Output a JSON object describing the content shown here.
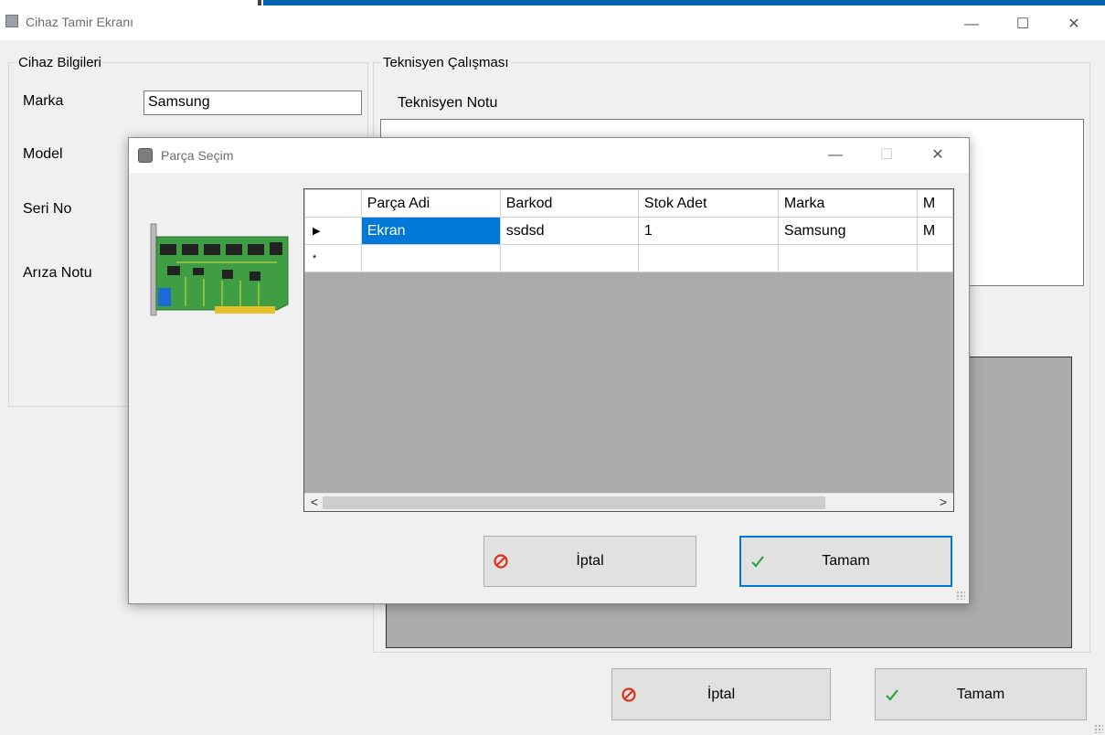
{
  "main_window": {
    "title": "Cihaz Tamir Ekranı",
    "minimize": "—",
    "maximize": "☐",
    "close": "✕"
  },
  "device_group": {
    "legend": "Cihaz Bilgileri",
    "marka_label": "Marka",
    "marka_value": "Samsung",
    "model_label": "Model",
    "serino_label": "Seri No",
    "ariza_label": "Arıza Notu"
  },
  "tech_group": {
    "legend": "Teknisyen Çalışması",
    "note_label": "Teknisyen Notu"
  },
  "main_buttons": {
    "cancel": "İptal",
    "ok": "Tamam"
  },
  "dialog": {
    "title": "Parça Seçim",
    "minimize": "—",
    "maximize": "☐",
    "close": "✕",
    "grid": {
      "columns": [
        "Parça Adi",
        "Barkod",
        "Stok Adet",
        "Marka",
        "M"
      ],
      "rows": [
        [
          "Ekran",
          "ssdsd",
          "1",
          "Samsung",
          "M"
        ]
      ],
      "current_row_marker": "▶",
      "new_row_marker": "*"
    },
    "scroll_left": "<",
    "scroll_right": ">",
    "cancel": "İptal",
    "ok": "Tamam"
  },
  "colors": {
    "selection": "#0078d7",
    "grid_background": "#ababab",
    "cancel_icon": "#e0301e",
    "ok_icon": "#2ea043"
  }
}
